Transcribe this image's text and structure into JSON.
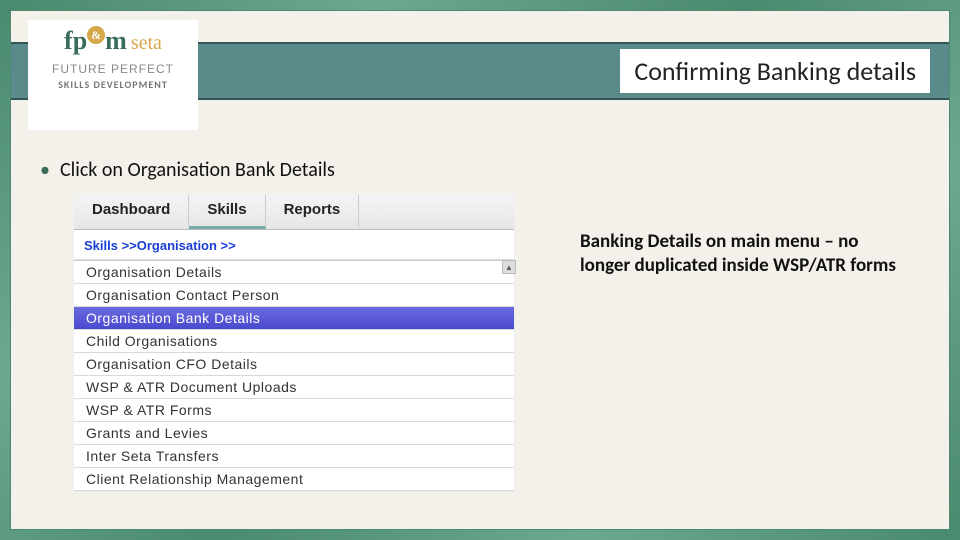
{
  "header": {
    "title": "Confirming Banking details"
  },
  "logo": {
    "main_left": "fp",
    "main_amp": "&",
    "main_m": "m",
    "main_right": "seta",
    "sub1": "FUTURE PERFECT",
    "sub2": "SKILLS DEVELOPMENT"
  },
  "instruction": {
    "bullet": "•",
    "text": "Click on Organisation Bank  Details"
  },
  "screenshot": {
    "tabs": [
      {
        "label": "Dashboard",
        "active": false
      },
      {
        "label": "Skills",
        "active": true
      },
      {
        "label": "Reports",
        "active": false
      }
    ],
    "breadcrumb": "Skills >>Organisation >>",
    "menu_items": [
      {
        "label": "Organisation Details",
        "selected": false
      },
      {
        "label": "Organisation Contact Person",
        "selected": false
      },
      {
        "label": "Organisation Bank Details",
        "selected": true
      },
      {
        "label": "Child Organisations",
        "selected": false
      },
      {
        "label": "Organisation CFO Details",
        "selected": false
      },
      {
        "label": "WSP & ATR Document Uploads",
        "selected": false
      },
      {
        "label": "WSP & ATR Forms",
        "selected": false
      },
      {
        "label": "Grants and Levies",
        "selected": false
      },
      {
        "label": "Inter Seta Transfers",
        "selected": false
      },
      {
        "label": "Client Relationship Management",
        "selected": false
      }
    ],
    "scroll_hint": "▲"
  },
  "note": "Banking Details on main menu – no longer duplicated inside WSP/ATR forms"
}
